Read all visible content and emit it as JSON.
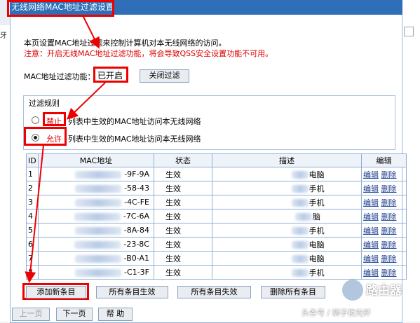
{
  "window": {
    "title": "无线网络MAC地址过滤设置",
    "left_edge_glyph": "牙"
  },
  "intro_text": "本页设置MAC地址过滤来控制计算机对本无线网络的访问。",
  "note_text": "注意：开启无线MAC地址过滤功能，将会导致QSS安全设置功能不可用。",
  "filter_status": {
    "label": "MAC地址过滤功能：",
    "value": "已开启",
    "toggle_button": "关闭过滤"
  },
  "rules": {
    "legend": "过滤规则",
    "deny_label": "禁止",
    "deny_desc": "列表中生效的MAC地址访问本无线网络",
    "allow_label": "允许",
    "allow_desc": "列表中生效的MAC地址访问本无线网络",
    "selected": "allow"
  },
  "table": {
    "headers": [
      "ID",
      "MAC地址",
      "状态",
      "描述",
      "编辑"
    ],
    "rows": [
      {
        "id": "1",
        "mac": "-9F-9A",
        "status": "生效",
        "desc": "电脑",
        "edit": "编辑",
        "delete": "删除"
      },
      {
        "id": "2",
        "mac": "-58-43",
        "status": "生效",
        "desc": "手机",
        "edit": "编辑",
        "delete": "删除"
      },
      {
        "id": "3",
        "mac": "-4C-FE",
        "status": "生效",
        "desc": "手机",
        "edit": "编辑",
        "delete": "删除"
      },
      {
        "id": "4",
        "mac": "-7C-6A",
        "status": "生效",
        "desc": "脑",
        "edit": "编辑",
        "delete": "删除"
      },
      {
        "id": "5",
        "mac": "-8A-84",
        "status": "生效",
        "desc": "手机",
        "edit": "编辑",
        "delete": "删除"
      },
      {
        "id": "6",
        "mac": "-23-8C",
        "status": "生效",
        "desc": "电脑",
        "edit": "编辑",
        "delete": "删除"
      },
      {
        "id": "7",
        "mac": "-B0-A1",
        "status": "生效",
        "desc": "电脑",
        "edit": "编辑",
        "delete": "删除"
      },
      {
        "id": "8",
        "mac": "-C1-3F",
        "status": "生效",
        "desc": "手机",
        "edit": "编辑",
        "delete": "删除"
      }
    ]
  },
  "actions": {
    "add": "添加新条目",
    "enable_all": "所有条目生效",
    "disable_all": "所有条目失效",
    "delete_all": "删除所有条目"
  },
  "pager": {
    "prev": "上一页",
    "next": "下一页",
    "help": "帮 助"
  },
  "watermark": {
    "brand": "路由器",
    "credit": "头条号 / 狮子夜光杯"
  },
  "colors": {
    "titlebar": "#2f6fb7",
    "highlight": "#e00000"
  }
}
